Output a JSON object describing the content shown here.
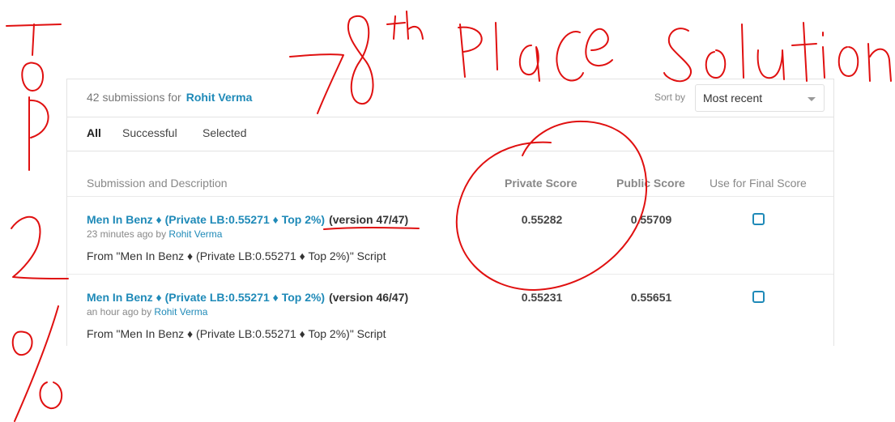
{
  "header": {
    "count_text": "42 submissions for",
    "user": "Rohit Verma",
    "sort_label": "Sort by",
    "sort_value": "Most recent"
  },
  "tabs": [
    {
      "label": "All",
      "active": true
    },
    {
      "label": "Successful",
      "active": false
    },
    {
      "label": "Selected",
      "active": false
    }
  ],
  "columns": {
    "submission": "Submission and Description",
    "private": "Private Score",
    "public": "Public Score",
    "final": "Use for Final Score"
  },
  "rows": [
    {
      "title": "Men In Benz ♦ (Private LB:0.55271 ♦ Top 2%)",
      "version": "(version 47/47)",
      "time": "23 minutes ago by",
      "author": "Rohit Verma",
      "description": "From \"Men In Benz ♦ (Private LB:0.55271 ♦ Top 2%)\" Script",
      "private_score": "0.55282",
      "public_score": "0.55709"
    },
    {
      "title": "Men In Benz ♦ (Private LB:0.55271 ♦ Top 2%)",
      "version": "(version 46/47)",
      "time": "an hour ago by",
      "author": "Rohit Verma",
      "description": "From \"Men In Benz ♦ (Private LB:0.55271 ♦ Top 2%)\" Script",
      "private_score": "0.55231",
      "public_score": "0.55651"
    }
  ],
  "annotation": {
    "ink_color": "#e01010"
  }
}
